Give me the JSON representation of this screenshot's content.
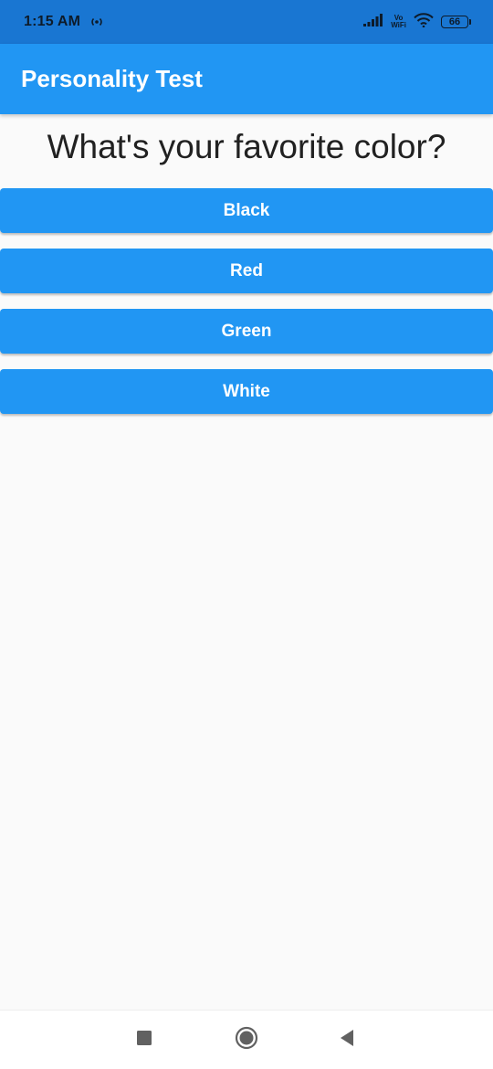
{
  "status_bar": {
    "time": "1:15 AM",
    "vowifi_top": "Vo",
    "vowifi_bottom": "WiFi",
    "battery_level": "66"
  },
  "app_bar": {
    "title": "Personality Test"
  },
  "quiz": {
    "question": "What's your favorite color?",
    "answers": [
      {
        "label": "Black"
      },
      {
        "label": "Red"
      },
      {
        "label": "Green"
      },
      {
        "label": "White"
      }
    ]
  },
  "nav_bar": {
    "icons": [
      "recents-square-icon",
      "home-circle-icon",
      "back-triangle-icon"
    ]
  },
  "colors": {
    "status_bar": "#1976d2",
    "primary": "#2196f3",
    "background": "#fafafa",
    "question_text": "#212121",
    "button_text": "#ffffff"
  }
}
